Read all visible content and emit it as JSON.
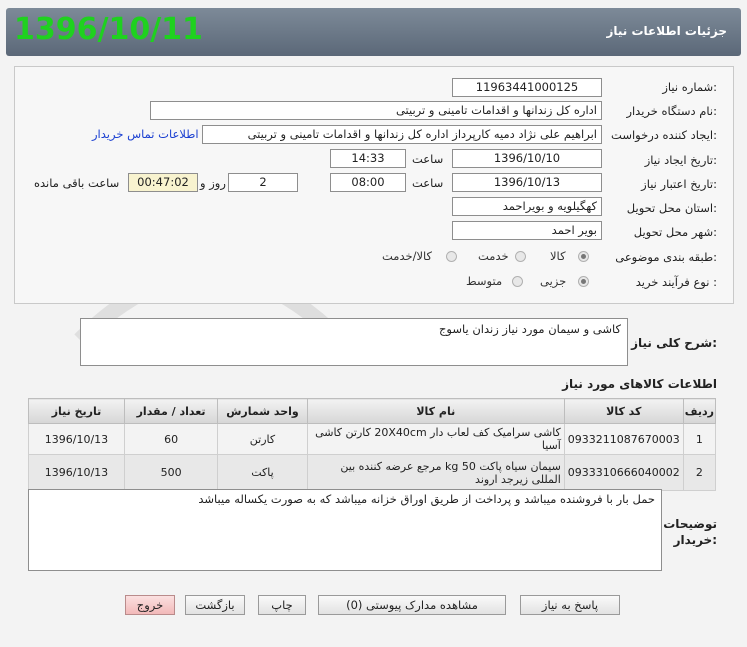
{
  "header": {
    "title": "جزئیات اطلاعات نیاز",
    "date": "1396/10/11"
  },
  "form": {
    "need_number_label": "شماره نیاز:",
    "need_number": "11963441000125",
    "buyer_org_label": "نام دستگاه خریدار:",
    "buyer_org": "اداره کل زندانها و اقدامات تامینی و تربیتی",
    "requester_label": "ایجاد کننده درخواست:",
    "requester": "ابراهیم علی نژاد دمیه کارپرداز اداره کل زندانها و اقدامات تامینی و تربیتی",
    "contact_link": "اطلاعات تماس خریدار",
    "created_label": "تاریخ ایجاد نیاز:",
    "created_date": "1396/10/10",
    "time_label": "ساعت",
    "created_time": "14:33",
    "validity_label": "تاریخ اعتبار نیاز:",
    "validity_date": "1396/10/13",
    "validity_time": "08:00",
    "days": "2",
    "days_label": "روز و",
    "remaining_time": "00:47:02",
    "remaining_label": "ساعت باقی مانده",
    "province_label": "استان محل تحویل:",
    "province": "کهگیلویه و بویراحمد",
    "city_label": "شهر محل تحویل:",
    "city": "بویر احمد",
    "category_label": "طبقه بندی موضوعی:",
    "category_options": [
      "کالا",
      "خدمت",
      "کالا/خدمت"
    ],
    "process_label": "نوع فرآیند خرید :",
    "process_options": [
      "جزیی",
      "متوسط"
    ]
  },
  "description": {
    "label": "شرح کلی نیاز:",
    "text": "کاشی و سیمان مورد نیاز زندان یاسوج"
  },
  "items_section": {
    "title": "اطلاعات کالاهای مورد نیاز",
    "columns": [
      "ردیف",
      "کد کالا",
      "نام کالا",
      "واحد شمارش",
      "تعداد / مقدار",
      "تاریخ نیاز"
    ],
    "rows": [
      [
        "1",
        "0933211087670003",
        "کاشی سرامیک کف لعاب دار 20X40cm کارتن کاشی آسیا",
        "کارتن",
        "60",
        "1396/10/13"
      ],
      [
        "2",
        "0933310666040002",
        "سیمان سیاه پاکت 50 kg مرجع عرضه کننده بین المللی زیرجد اروند",
        "پاکت",
        "500",
        "1396/10/13"
      ]
    ]
  },
  "notes": {
    "label_line1": "توضیحات",
    "label_line2": "خریدار:",
    "text": "حمل بار با فروشنده میباشد و پرداخت از طریق اوراق خزانه میباشد که به صورت یکساله  میباشد"
  },
  "buttons": {
    "reply": "پاسخ به نیاز",
    "attachments": "مشاهده مدارک پیوستی (0)",
    "print": "چاپ",
    "back": "بازگشت",
    "exit": "خروج"
  },
  "colors": {
    "header_bg": "#6b7886",
    "date_green": "#1fd11f",
    "link_blue": "#1a3fd1",
    "timer_bg": "#f8f3cf",
    "exit_btn": "#f2b9b9"
  }
}
